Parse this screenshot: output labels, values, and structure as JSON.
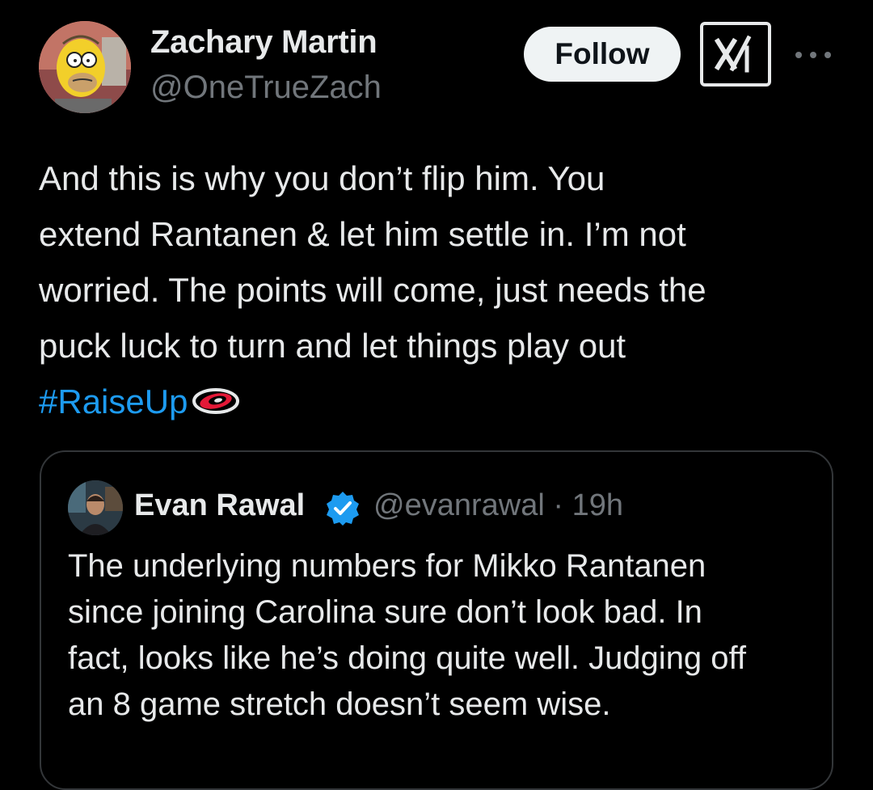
{
  "tweet": {
    "author": {
      "name": "Zachary Martin",
      "handle": "@OneTrueZach"
    },
    "follow_label": "Follow",
    "more_icon": "more-dots-icon",
    "grok_icon": "grok-icon",
    "text_lines": [
      "And this is why you don’t flip him. You",
      "extend Rantanen & let him settle in. I’m not",
      "worried. The points will come, just needs the",
      "puck luck to turn and let things play out"
    ],
    "hashtag": "#RaiseUp",
    "hashflag_icon": "hurricanes-logo-icon"
  },
  "quote": {
    "author": {
      "name": "Evan Rawal",
      "handle": "@evanrawal",
      "time": " · 19h",
      "verified": true
    },
    "text_lines": [
      "The underlying numbers for Mikko Rantanen",
      "since joining Carolina sure don’t look bad. In",
      "fact, looks like he’s doing quite well. Judging off",
      "an 8 game stretch doesn’t seem wise."
    ]
  },
  "colors": {
    "background": "#000000",
    "text": "#e7e9ea",
    "secondary": "#71767b",
    "link": "#1d9bf0",
    "border": "#333639",
    "verified": "#1d9bf0"
  }
}
